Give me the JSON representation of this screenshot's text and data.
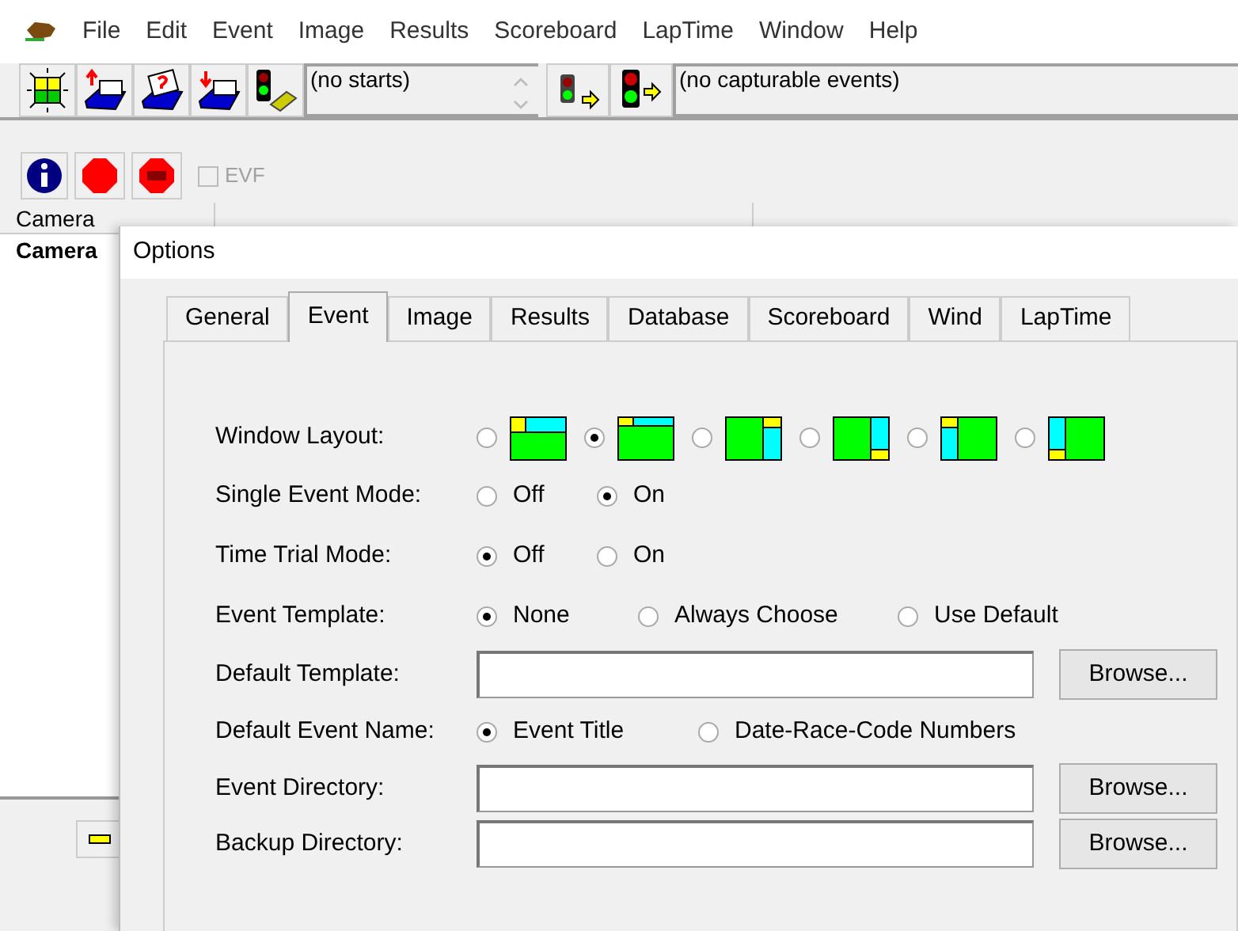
{
  "menu": [
    "File",
    "Edit",
    "Event",
    "Image",
    "Results",
    "Scoreboard",
    "LapTime",
    "Window",
    "Help"
  ],
  "toolbar": {
    "starts_list": "(no starts)",
    "events_list": "(no capturable events)"
  },
  "toolbar2": {
    "evf": {
      "label": "EVF",
      "checked": false,
      "disabled": true
    }
  },
  "camera_list": {
    "columns": [
      "Camera"
    ],
    "rows": [
      "Camera"
    ]
  },
  "options_dialog": {
    "title": "Options",
    "tabs": [
      {
        "label": "General",
        "selected": false
      },
      {
        "label": "Event",
        "selected": true
      },
      {
        "label": "Image",
        "selected": false
      },
      {
        "label": "Results",
        "selected": false
      },
      {
        "label": "Database",
        "selected": false
      },
      {
        "label": "Scoreboard",
        "selected": false
      },
      {
        "label": "Wind",
        "selected": false
      },
      {
        "label": "LapTime",
        "selected": false
      }
    ],
    "rows": [
      {
        "kind": "layout",
        "label": "Window Layout:",
        "options": [
          {
            "selected": false
          },
          {
            "selected": true
          },
          {
            "selected": false
          },
          {
            "selected": false
          },
          {
            "selected": false
          },
          {
            "selected": false
          }
        ]
      },
      {
        "kind": "radio",
        "label": "Single Event Mode:",
        "options": [
          {
            "label": "Off",
            "selected": false
          },
          {
            "label": "On",
            "selected": true
          }
        ]
      },
      {
        "kind": "radio",
        "label": "Time Trial Mode:",
        "options": [
          {
            "label": "Off",
            "selected": true
          },
          {
            "label": "On",
            "selected": false
          }
        ]
      },
      {
        "kind": "radio",
        "label": "Event Template:",
        "options": [
          {
            "label": "None",
            "selected": true
          },
          {
            "label": "Always Choose",
            "selected": false
          },
          {
            "label": "Use Default",
            "selected": false
          }
        ]
      },
      {
        "kind": "field",
        "label": "Default Template:",
        "button": "Browse..."
      },
      {
        "kind": "radio",
        "label": "Default Event Name:",
        "options": [
          {
            "label": "Event Title",
            "selected": true
          },
          {
            "label": "Date-Race-Code Numbers",
            "selected": false
          }
        ]
      },
      {
        "kind": "field",
        "label": "Event Directory:",
        "button": "Browse..."
      },
      {
        "kind": "field",
        "label": "Backup Directory:",
        "button": "Browse..."
      }
    ]
  }
}
